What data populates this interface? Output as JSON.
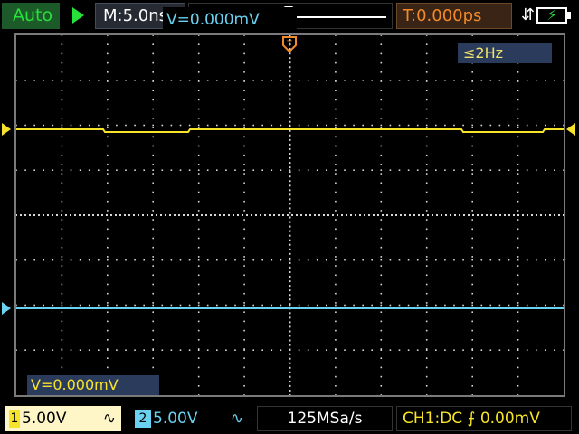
{
  "top": {
    "mode": "Auto",
    "timebase": "M:5.0ns",
    "trigger_position": "T:0.000ps",
    "usb_icon": "usb-icon",
    "battery_icon": "battery-charging-icon"
  },
  "plot": {
    "frequency": "≤2Hz",
    "trigger_marker": "T",
    "measurements": {
      "ch1": "V=0.000mV",
      "ch2": "V=0.000mV"
    }
  },
  "bottom": {
    "ch1": {
      "index": "1",
      "scale": "5.00V",
      "coupling_icon": "∿"
    },
    "ch2": {
      "index": "2",
      "scale": "5.00V",
      "coupling_icon": "∿"
    },
    "sample_rate": "125MSa/s",
    "trigger_info": "CH1:DC ⨍ 0.00mV"
  },
  "colors": {
    "ch1": "#f6e32a",
    "ch2": "#6ad2f0",
    "accent_green": "#28e03a",
    "trigger_orange": "#f08a2a"
  }
}
